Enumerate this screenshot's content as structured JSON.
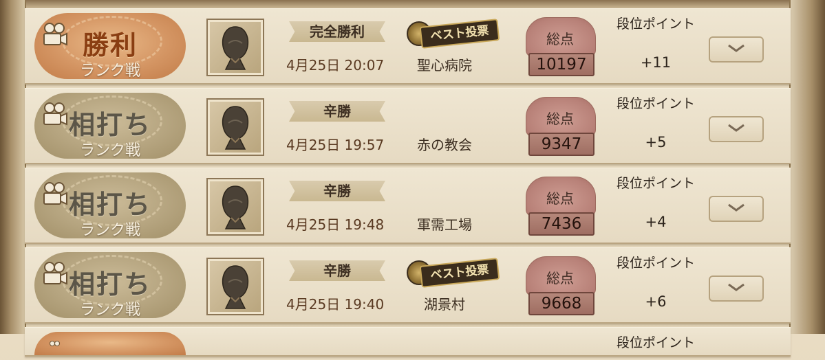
{
  "matches": [
    {
      "result": "勝利",
      "result_type": "win",
      "mode": "ランク戦",
      "outcome": "完全勝利",
      "best_badge": "ベスト投票",
      "datetime": "4月25日 20:07",
      "map": "聖心病院",
      "score_label": "総点",
      "score": "10197",
      "points_label": "段位ポイント",
      "points": "+11"
    },
    {
      "result": "相打ち",
      "result_type": "draw",
      "mode": "ランク戦",
      "outcome": "辛勝",
      "best_badge": "",
      "datetime": "4月25日 19:57",
      "map": "赤の教会",
      "score_label": "総点",
      "score": "9347",
      "points_label": "段位ポイント",
      "points": "+5"
    },
    {
      "result": "相打ち",
      "result_type": "draw",
      "mode": "ランク戦",
      "outcome": "辛勝",
      "best_badge": "",
      "datetime": "4月25日 19:48",
      "map": "軍需工場",
      "score_label": "総点",
      "score": "7436",
      "points_label": "段位ポイント",
      "points": "+4"
    },
    {
      "result": "相打ち",
      "result_type": "draw",
      "mode": "ランク戦",
      "outcome": "辛勝",
      "best_badge": "ベスト投票",
      "datetime": "4月25日 19:40",
      "map": "湖景村",
      "score_label": "総点",
      "score": "9668",
      "points_label": "段位ポイント",
      "points": "+6"
    },
    {
      "points_label": "段位ポイント"
    }
  ],
  "icons": {
    "replay": "film-camera-icon",
    "expand": "chevron-down-icon",
    "avatar": "hooded-character-portrait"
  },
  "colors": {
    "win_medal": "#d49563",
    "draw_medal": "#b5a47f",
    "score_box": "#b88178"
  }
}
